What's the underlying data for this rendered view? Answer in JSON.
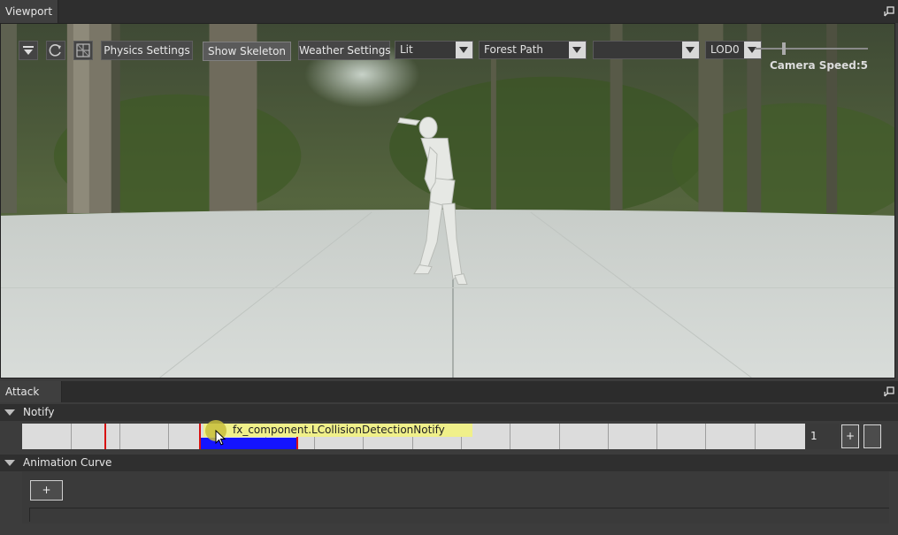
{
  "viewport_panel": {
    "tab_label": "Viewport",
    "toolbar": {
      "physics_settings_label": "Physics Settings",
      "show_skeleton_label": "Show Skeleton",
      "weather_settings_label": "Weather Settings",
      "shading_value": "Lit",
      "environment_value": "Forest Path",
      "empty_select_value": "",
      "lod_value": "LOD0",
      "camera_speed_label": "Camera Speed:5"
    },
    "camera_speed": 5
  },
  "attack_panel": {
    "tab_label": "Attack",
    "notify_section": {
      "header": "Notify",
      "notify_label": "fx_component.LCollisionDetectionNotify",
      "track_count": "1",
      "add_button_label": "+"
    },
    "curve_section": {
      "header": "Animation Curve",
      "add_button_label": "+"
    }
  },
  "colors": {
    "marker": "#d81010",
    "notify_bar": "#1414ff",
    "notify_label_bg": "#f0f08a"
  }
}
